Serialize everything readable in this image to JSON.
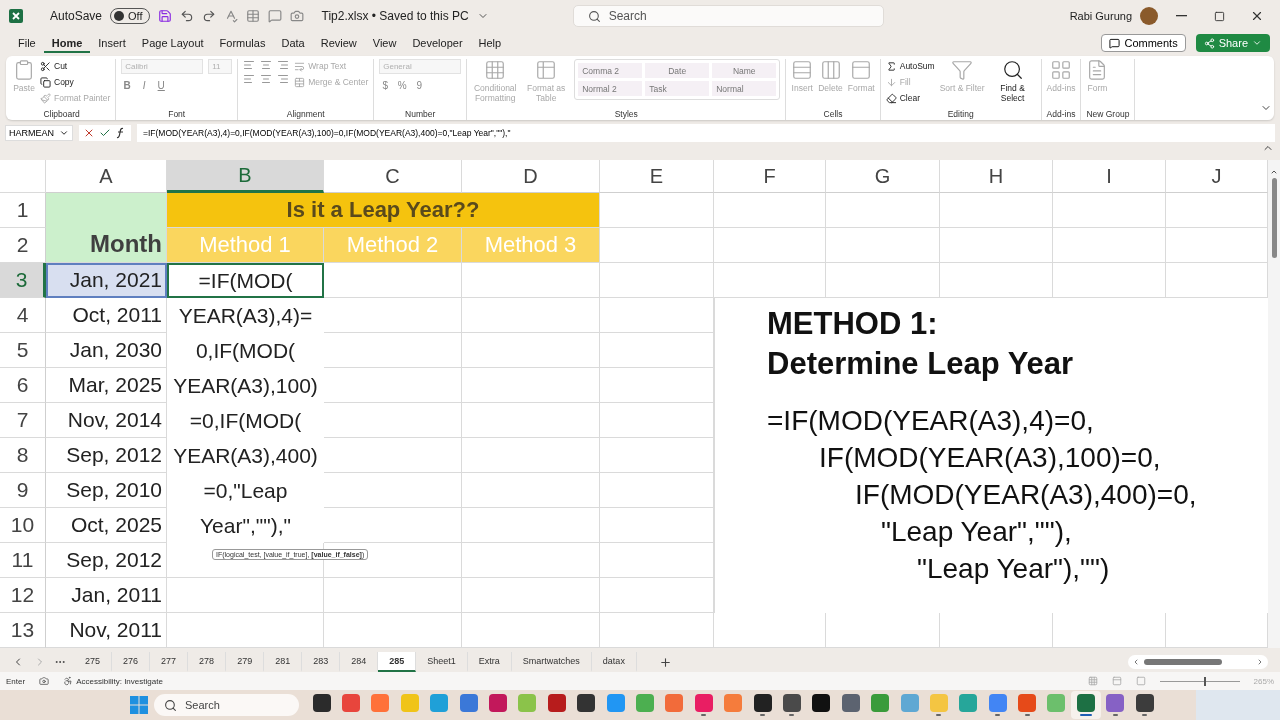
{
  "title_bar": {
    "autosave": {
      "label": "AutoSave",
      "state": "Off",
      "on": false
    },
    "file": "Tip2.xlsx • Saved to this PC",
    "search": {
      "placeholder": "Search"
    },
    "user": "Rabi Gurung"
  },
  "menu": {
    "tabs": [
      {
        "label": "File",
        "selected": false
      },
      {
        "label": "Home",
        "selected": true
      },
      {
        "label": "Insert",
        "selected": false
      },
      {
        "label": "Page Layout",
        "selected": false
      },
      {
        "label": "Formulas",
        "selected": false
      },
      {
        "label": "Data",
        "selected": false
      },
      {
        "label": "Review",
        "selected": false
      },
      {
        "label": "View",
        "selected": false
      },
      {
        "label": "Developer",
        "selected": false
      },
      {
        "label": "Help",
        "selected": false
      }
    ],
    "comments": "Comments",
    "share": "Share"
  },
  "ribbon": {
    "groups": [
      {
        "name": "Clipboard",
        "items": [
          {
            "kind": "large",
            "label": "Paste",
            "disabled": true
          },
          {
            "kind": "small",
            "label": "Cut",
            "disabled": false
          },
          {
            "kind": "small",
            "label": "Copy",
            "disabled": false
          },
          {
            "kind": "small",
            "label": "Format Painter",
            "disabled": true
          }
        ]
      },
      {
        "name": "Font",
        "items": [
          {
            "kind": "field",
            "label": "Calibri",
            "disabled": true
          },
          {
            "kind": "field",
            "label": "11",
            "disabled": true
          },
          {
            "kind": "format",
            "label": "B",
            "disabled": true
          },
          {
            "kind": "format",
            "label": "I",
            "disabled": true
          },
          {
            "kind": "format",
            "label": "U",
            "disabled": true
          }
        ]
      },
      {
        "name": "Alignment",
        "items": [
          {
            "kind": "small",
            "label": "Wrap Text",
            "disabled": true
          },
          {
            "kind": "small",
            "label": "Merge & Center",
            "disabled": true
          }
        ]
      },
      {
        "name": "Number",
        "items": [
          {
            "kind": "field",
            "label": "General",
            "disabled": true
          },
          {
            "kind": "format",
            "label": "$",
            "disabled": true
          },
          {
            "kind": "format",
            "label": "%",
            "disabled": true
          },
          {
            "kind": "format",
            "label": "9",
            "disabled": true
          }
        ]
      },
      {
        "name": "Styles",
        "items": [
          {
            "kind": "large",
            "label": "Conditional Formatting",
            "disabled": true
          },
          {
            "kind": "large",
            "label": "Format as Table",
            "disabled": true
          }
        ],
        "gallery": [
          "Comma 2",
          "Date",
          "Name",
          "Normal 2",
          "Task",
          "Normal"
        ]
      },
      {
        "name": "Cells",
        "items": [
          {
            "kind": "large",
            "label": "Insert",
            "disabled": true
          },
          {
            "kind": "large",
            "label": "Delete",
            "disabled": true
          },
          {
            "kind": "large",
            "label": "Format",
            "disabled": true
          }
        ]
      },
      {
        "name": "Editing",
        "items": [
          {
            "kind": "small",
            "label": "AutoSum",
            "disabled": false
          },
          {
            "kind": "small",
            "label": "Fill",
            "disabled": true
          },
          {
            "kind": "small",
            "label": "Clear",
            "disabled": false
          },
          {
            "kind": "large",
            "label": "Sort & Filter",
            "disabled": true
          },
          {
            "kind": "large",
            "label": "Find & Select",
            "disabled": false
          }
        ]
      },
      {
        "name": "Add-ins",
        "items": [
          {
            "kind": "large",
            "label": "Add-ins",
            "disabled": true
          }
        ]
      },
      {
        "name": "New Group",
        "items": [
          {
            "kind": "large",
            "label": "Form",
            "disabled": true
          }
        ]
      }
    ]
  },
  "formula_bar": {
    "name_box": "HARMEAN",
    "formula": "=IF(MOD(YEAR(A3),4)=0,IF(MOD(YEAR(A3),100)=0,IF(MOD(YEAR(A3),400)=0,\"Leap Year\",\"\"),\""
  },
  "sheet": {
    "columns": [
      {
        "label": "A",
        "selected": false
      },
      {
        "label": "B",
        "selected": true
      },
      {
        "label": "C",
        "selected": false
      },
      {
        "label": "D",
        "selected": false
      },
      {
        "label": "E",
        "selected": false
      },
      {
        "label": "F",
        "selected": false
      },
      {
        "label": "G",
        "selected": false
      },
      {
        "label": "H",
        "selected": false
      },
      {
        "label": "I",
        "selected": false
      },
      {
        "label": "J",
        "selected": false
      }
    ],
    "rows": [
      {
        "label": "1",
        "selected": false
      },
      {
        "label": "2",
        "selected": false
      },
      {
        "label": "3",
        "selected": true
      },
      {
        "label": "4",
        "selected": false
      },
      {
        "label": "5",
        "selected": false
      },
      {
        "label": "6",
        "selected": false
      },
      {
        "label": "7",
        "selected": false
      },
      {
        "label": "8",
        "selected": false
      },
      {
        "label": "9",
        "selected": false
      },
      {
        "label": "10",
        "selected": false
      },
      {
        "label": "11",
        "selected": false
      },
      {
        "label": "12",
        "selected": false
      },
      {
        "label": "13",
        "selected": false
      }
    ],
    "title": "Is it a Leap Year??",
    "month_header": "Month",
    "methods": [
      "Method 1",
      "Method 2",
      "Method 3"
    ],
    "months": [
      {
        "value": "Jan, 2021",
        "selected": true
      },
      {
        "value": "Oct, 2011",
        "selected": false
      },
      {
        "value": "Jan, 2030",
        "selected": false
      },
      {
        "value": "Mar, 2025",
        "selected": false
      },
      {
        "value": "Nov, 2014",
        "selected": false
      },
      {
        "value": "Sep, 2012",
        "selected": false
      },
      {
        "value": "Sep, 2010",
        "selected": false
      },
      {
        "value": "Oct, 2025",
        "selected": false
      },
      {
        "value": "Sep, 2012",
        "selected": false
      },
      {
        "value": "Jan, 2011",
        "selected": false
      },
      {
        "value": "Nov, 2011",
        "selected": false
      }
    ],
    "editing_lines": [
      "=IF(MOD(",
      "YEAR(A3),4)=",
      "0,IF(MOD(",
      "YEAR(A3),100)",
      "=0,IF(MOD(",
      "YEAR(A3),400)",
      "=0,\"Leap",
      "Year\",\"\"),\""
    ],
    "tooltip": "IF(logical_test, [value_if_true], **[value_if_false]**)",
    "note": {
      "title": [
        "METHOD 1:",
        "Determine Leap Year"
      ],
      "formula_lines": [
        "=IF(MOD(YEAR(A3),4)=0,",
        "IF(MOD(YEAR(A3),100)=0,",
        "IF(MOD(YEAR(A3),400)=0,",
        "\"Leap Year\",\"\"),",
        "\"Leap Year\"),\"\")"
      ]
    }
  },
  "sheet_tabs": [
    {
      "label": "275",
      "selected": false
    },
    {
      "label": "276",
      "selected": false
    },
    {
      "label": "277",
      "selected": false
    },
    {
      "label": "278",
      "selected": false
    },
    {
      "label": "279",
      "selected": false
    },
    {
      "label": "281",
      "selected": false
    },
    {
      "label": "283",
      "selected": false
    },
    {
      "label": "284",
      "selected": false
    },
    {
      "label": "285",
      "selected": true
    },
    {
      "label": "Sheet1",
      "selected": false
    },
    {
      "label": "Extra",
      "selected": false
    },
    {
      "label": "Smartwatches",
      "selected": false
    },
    {
      "label": "datax",
      "selected": false
    }
  ],
  "status_bar": {
    "mode": "Enter",
    "accessibility": "Accessibility: Investigate",
    "zoom_slider": {
      "level": 0.55
    },
    "zoom": "265%"
  },
  "taskbar": {
    "search": {
      "placeholder": "Search"
    },
    "apps": [
      {
        "color": "#2b2b2b",
        "running": false,
        "selected": false
      },
      {
        "color": "#e8453c",
        "running": false,
        "selected": false
      },
      {
        "color": "#ff7139",
        "running": false,
        "selected": false
      },
      {
        "color": "#f0c419",
        "running": false,
        "selected": false
      },
      {
        "color": "#1fa0d8",
        "running": false,
        "selected": false
      },
      {
        "color": "#3b78d8",
        "running": false,
        "selected": false
      },
      {
        "color": "#c2185b",
        "running": false,
        "selected": false
      },
      {
        "color": "#8bc34a",
        "running": false,
        "selected": false
      },
      {
        "color": "#b71c1c",
        "running": false,
        "selected": false
      },
      {
        "color": "#333333",
        "running": false,
        "selected": false
      },
      {
        "color": "#2196f3",
        "running": false,
        "selected": false
      },
      {
        "color": "#4caf50",
        "running": false,
        "selected": false
      },
      {
        "color": "#f26b3a",
        "running": false,
        "selected": false
      },
      {
        "color": "#e91e63",
        "running": true,
        "selected": false
      },
      {
        "color": "#f57c3c",
        "running": false,
        "selected": false
      },
      {
        "color": "#222222",
        "running": true,
        "selected": false
      },
      {
        "color": "#4a4a4a",
        "running": true,
        "selected": false
      },
      {
        "color": "#111111",
        "running": false,
        "selected": false
      },
      {
        "color": "#5c6370",
        "running": false,
        "selected": false
      },
      {
        "color": "#3a9b3a",
        "running": false,
        "selected": false
      },
      {
        "color": "#5fa8d3",
        "running": false,
        "selected": false
      },
      {
        "color": "#f4c542",
        "running": true,
        "selected": false
      },
      {
        "color": "#26a69a",
        "running": false,
        "selected": false
      },
      {
        "color": "#4285f4",
        "running": true,
        "selected": false
      },
      {
        "color": "#e64a19",
        "running": true,
        "selected": false
      },
      {
        "color": "#6cbf6c",
        "running": false,
        "selected": false
      },
      {
        "color": "#1d7044",
        "running": true,
        "selected": true
      },
      {
        "color": "#8661c5",
        "running": true,
        "selected": false
      },
      {
        "color": "#3c3c3c",
        "running": true,
        "selected": false
      }
    ]
  }
}
